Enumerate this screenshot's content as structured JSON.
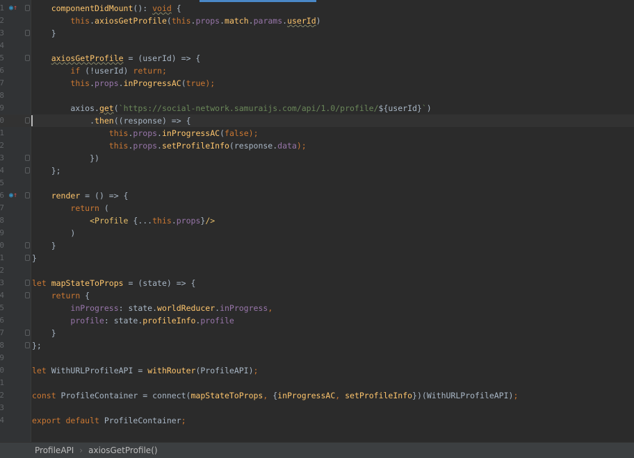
{
  "editor": {
    "lines": [
      {
        "n": "1",
        "icon": true,
        "fold": true,
        "tokens": [
          [
            "    ",
            ""
          ],
          [
            "componentDidMount",
            "fn"
          ],
          [
            "(): ",
            ""
          ],
          [
            "void",
            "kw wavy"
          ],
          [
            " {",
            ""
          ]
        ]
      },
      {
        "n": "2",
        "tokens": [
          [
            "        ",
            ""
          ],
          [
            "this",
            "kw"
          ],
          [
            ".",
            ""
          ],
          [
            "axiosGetProfile",
            "fn"
          ],
          [
            "(",
            ""
          ],
          [
            "this",
            "kw"
          ],
          [
            ".",
            ""
          ],
          [
            "props",
            "fld"
          ],
          [
            ".",
            ""
          ],
          [
            "match",
            "fn"
          ],
          [
            ".",
            ""
          ],
          [
            "params",
            "fld"
          ],
          [
            ".",
            ""
          ],
          [
            "userId",
            "fn wavy"
          ],
          [
            ")",
            ""
          ]
        ]
      },
      {
        "n": "3",
        "fold": true,
        "tokens": [
          [
            "    }",
            ""
          ]
        ]
      },
      {
        "n": "4",
        "tokens": []
      },
      {
        "n": "5",
        "fold": true,
        "tokens": [
          [
            "    ",
            ""
          ],
          [
            "axiosGetProfile",
            "fn wavy"
          ],
          [
            " = (userId) => {",
            ""
          ]
        ]
      },
      {
        "n": "6",
        "tokens": [
          [
            "        ",
            ""
          ],
          [
            "if",
            "kw"
          ],
          [
            " (!userId) ",
            ""
          ],
          [
            "return;",
            "kw"
          ]
        ]
      },
      {
        "n": "7",
        "tokens": [
          [
            "        ",
            ""
          ],
          [
            "this",
            "kw"
          ],
          [
            ".",
            ""
          ],
          [
            "props",
            "fld"
          ],
          [
            ".",
            ""
          ],
          [
            "inProgressAC",
            "fn"
          ],
          [
            "(",
            ""
          ],
          [
            "true",
            "kw"
          ],
          [
            ");",
            "kw"
          ]
        ]
      },
      {
        "n": "8",
        "tokens": []
      },
      {
        "n": "9",
        "tokens": [
          [
            "        axios.",
            ""
          ],
          [
            "get",
            "fn wavy"
          ],
          [
            "(",
            ""
          ],
          [
            "`https://social-network.samuraijs.com/api/1.0/profile/",
            "str"
          ],
          [
            "${userId}",
            ""
          ],
          [
            "`",
            "str"
          ],
          [
            ")",
            ""
          ]
        ]
      },
      {
        "n": "0",
        "fold": true,
        "current": true,
        "tokens": [
          [
            "            .",
            ""
          ],
          [
            "then",
            "fn"
          ],
          [
            "((response) => {",
            ""
          ]
        ]
      },
      {
        "n": "1",
        "tokens": [
          [
            "                ",
            ""
          ],
          [
            "this",
            "kw"
          ],
          [
            ".",
            ""
          ],
          [
            "props",
            "fld"
          ],
          [
            ".",
            ""
          ],
          [
            "inProgressAC",
            "fn"
          ],
          [
            "(",
            ""
          ],
          [
            "false",
            "kw"
          ],
          [
            ");",
            "kw"
          ]
        ]
      },
      {
        "n": "2",
        "tokens": [
          [
            "                ",
            ""
          ],
          [
            "this",
            "kw"
          ],
          [
            ".",
            ""
          ],
          [
            "props",
            "fld"
          ],
          [
            ".",
            ""
          ],
          [
            "setProfileInfo",
            "fn"
          ],
          [
            "(response.",
            ""
          ],
          [
            "data",
            "fld"
          ],
          [
            ");",
            "kw"
          ]
        ]
      },
      {
        "n": "3",
        "fold": true,
        "tokens": [
          [
            "            })",
            ""
          ]
        ]
      },
      {
        "n": "4",
        "fold": true,
        "tokens": [
          [
            "    };",
            ""
          ]
        ]
      },
      {
        "n": "5",
        "tokens": []
      },
      {
        "n": "6",
        "icon": true,
        "fold": true,
        "tokens": [
          [
            "    ",
            ""
          ],
          [
            "render",
            "fn"
          ],
          [
            " = () => {",
            ""
          ]
        ]
      },
      {
        "n": "7",
        "tokens": [
          [
            "        ",
            ""
          ],
          [
            "return",
            "kw"
          ],
          [
            " (",
            ""
          ]
        ]
      },
      {
        "n": "8",
        "tokens": [
          [
            "            ",
            ""
          ],
          [
            "<Profile",
            "tag"
          ],
          [
            " {...",
            ""
          ],
          [
            "this",
            "kw"
          ],
          [
            ".",
            ""
          ],
          [
            "props",
            "fld"
          ],
          [
            "}",
            ""
          ],
          [
            "/>",
            "tag"
          ]
        ]
      },
      {
        "n": "9",
        "tokens": [
          [
            "        )",
            ""
          ]
        ]
      },
      {
        "n": "0",
        "fold": true,
        "tokens": [
          [
            "    }",
            ""
          ]
        ]
      },
      {
        "n": "1",
        "fold": true,
        "tokens": [
          [
            "}",
            ""
          ]
        ]
      },
      {
        "n": "2",
        "tokens": []
      },
      {
        "n": "3",
        "fold": true,
        "tokens": [
          [
            "let",
            "kw"
          ],
          [
            " ",
            ""
          ],
          [
            "mapStateToProps",
            "fn"
          ],
          [
            " = (state) => {",
            ""
          ]
        ]
      },
      {
        "n": "4",
        "fold": true,
        "tokens": [
          [
            "    ",
            ""
          ],
          [
            "return",
            "kw"
          ],
          [
            " {",
            ""
          ]
        ]
      },
      {
        "n": "5",
        "tokens": [
          [
            "        ",
            ""
          ],
          [
            "inProgress",
            "fld"
          ],
          [
            ": state.",
            ""
          ],
          [
            "worldReducer",
            "fn"
          ],
          [
            ".",
            ""
          ],
          [
            "inProgress",
            "fld"
          ],
          [
            ",",
            "kw"
          ]
        ]
      },
      {
        "n": "6",
        "tokens": [
          [
            "        ",
            ""
          ],
          [
            "profile",
            "fld"
          ],
          [
            ": state.",
            ""
          ],
          [
            "profileInfo",
            "fn"
          ],
          [
            ".",
            ""
          ],
          [
            "profile",
            "fld"
          ]
        ]
      },
      {
        "n": "7",
        "fold": true,
        "tokens": [
          [
            "    }",
            ""
          ]
        ]
      },
      {
        "n": "8",
        "fold": true,
        "tokens": [
          [
            "};",
            ""
          ]
        ]
      },
      {
        "n": "9",
        "tokens": []
      },
      {
        "n": "0",
        "tokens": [
          [
            "let",
            "kw"
          ],
          [
            " WithURLProfileAPI = ",
            ""
          ],
          [
            "withRouter",
            "fn"
          ],
          [
            "(ProfileAPI)",
            ""
          ],
          [
            ";",
            "kw"
          ]
        ]
      },
      {
        "n": "1",
        "tokens": []
      },
      {
        "n": "2",
        "tokens": [
          [
            "const",
            "kw"
          ],
          [
            " ProfileContainer = connect(",
            ""
          ],
          [
            "mapStateToProps",
            "fn"
          ],
          [
            ", ",
            "kw"
          ],
          [
            "{",
            ""
          ],
          [
            "inProgressAC",
            "fn"
          ],
          [
            ", ",
            "kw"
          ],
          [
            "setProfileInfo",
            "fn"
          ],
          [
            "})(WithURLProfileAPI)",
            ""
          ],
          [
            ";",
            "kw"
          ]
        ]
      },
      {
        "n": "3",
        "tokens": []
      },
      {
        "n": "4",
        "tokens": [
          [
            "export",
            "kw"
          ],
          [
            " ",
            ""
          ],
          [
            "default",
            "kw"
          ],
          [
            " ProfileContainer",
            ""
          ],
          [
            ";",
            "kw"
          ]
        ]
      }
    ]
  },
  "breadcrumb": {
    "class_name": "ProfileAPI",
    "method": "axiosGetProfile()",
    "separator": "›"
  },
  "colors": {
    "background": "#2b2b2b",
    "keyword": "#cc7832",
    "function": "#ffc66d",
    "field": "#9876aa",
    "string": "#6a8759"
  }
}
